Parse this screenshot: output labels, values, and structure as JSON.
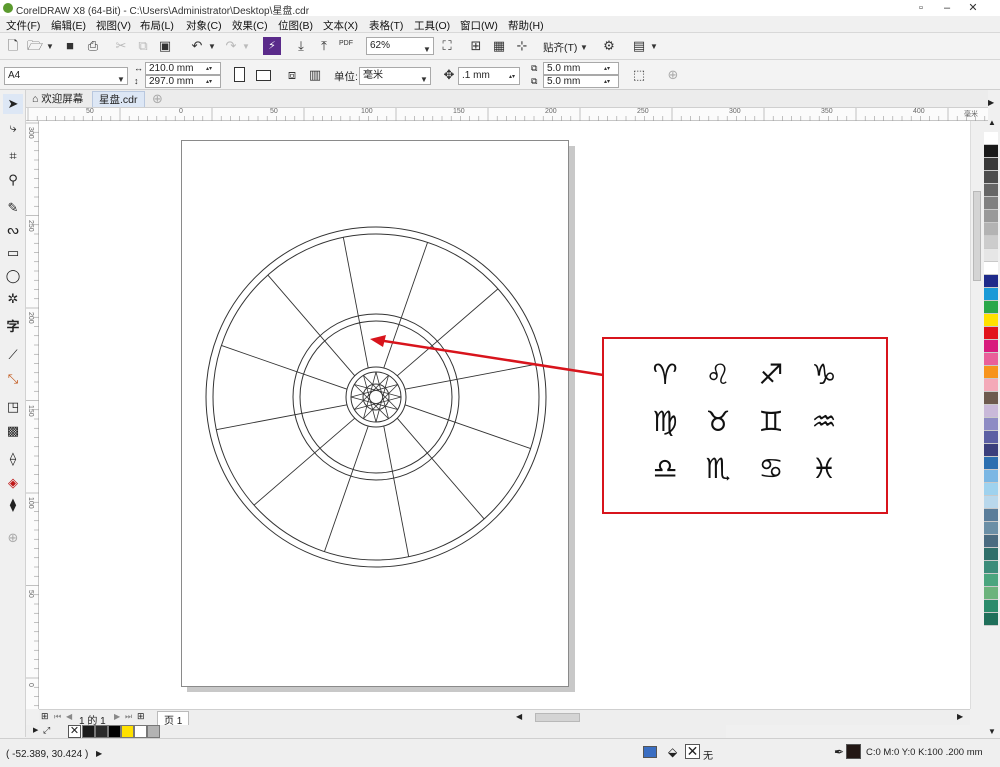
{
  "window": {
    "title": "CorelDRAW X8 (64-Bit) - C:\\Users\\Administrator\\Desktop\\星盘.cdr"
  },
  "menu": [
    "文件(F)",
    "编辑(E)",
    "视图(V)",
    "布局(L)",
    "对象(C)",
    "效果(C)",
    "位图(B)",
    "文本(X)",
    "表格(T)",
    "工具(O)",
    "窗口(W)",
    "帮助(H)"
  ],
  "toolbar": {
    "zoom": "62%",
    "snap_label": "贴齐(T)",
    "pdf_label": "PDF"
  },
  "property_bar": {
    "paper": "A4",
    "width": "210.0 mm",
    "height": "297.0 mm",
    "units_label": "单位:",
    "units": "毫米",
    "nudge": ".1 mm",
    "dup_x": "5.0 mm",
    "dup_y": "5.0 mm"
  },
  "tabs": [
    {
      "label": "欢迎屏幕",
      "active": false
    },
    {
      "label": "星盘.cdr",
      "active": true
    }
  ],
  "ruler_h": [
    "50",
    "0",
    "50",
    "100",
    "150",
    "200",
    "250",
    "300",
    "350",
    "400"
  ],
  "ruler_h_unit": "毫米",
  "ruler_v": [
    "300",
    "250",
    "200",
    "150",
    "100",
    "50",
    "0"
  ],
  "zodiac_symbols": [
    "♈",
    "♌",
    "♐",
    "♑",
    "♍",
    "♉",
    "♊",
    "♒",
    "♎",
    "♏",
    "♋",
    "♓"
  ],
  "pagebar": {
    "page_of": "1 的 1",
    "page_tab": "页 1"
  },
  "status": {
    "coords": "( -52.389, 30.424 )",
    "fill_label": "无",
    "outline_info": "C:0 M:0 Y:0 K:100  .200 mm"
  },
  "colors": {
    "accent_red": "#d8141c",
    "palette": [
      "#ffffff",
      "#1a1a1a",
      "#3a3a3a",
      "#4d4d4d",
      "#666666",
      "#808080",
      "#999999",
      "#b3b3b3",
      "#cccccc",
      "#e6e6e6",
      "#ffffff",
      "#1e2a8a",
      "#1a9ad7",
      "#2aa84a",
      "#ffe100",
      "#e2141c",
      "#d81b7d",
      "#e95f9a",
      "#f7941d",
      "#f4a9b8",
      "#6d5a4e",
      "#c9b9d9",
      "#8e8cc4",
      "#5c5fa3",
      "#3b3f7c",
      "#2c6fb0",
      "#7bb7e4",
      "#9fd2ee",
      "#b9d8ec",
      "#5a7d9a",
      "#6b8fa6",
      "#4a6b80",
      "#2f6f6a",
      "#3c8c7a",
      "#4aa57e",
      "#6cb37c",
      "#2b8b6b",
      "#1f6f5a"
    ]
  },
  "doc_palette": [
    "#1a1a1a",
    "#2a2a2a",
    "#000000",
    "#ffe100",
    "#ffffff",
    "#b3b3b3"
  ]
}
